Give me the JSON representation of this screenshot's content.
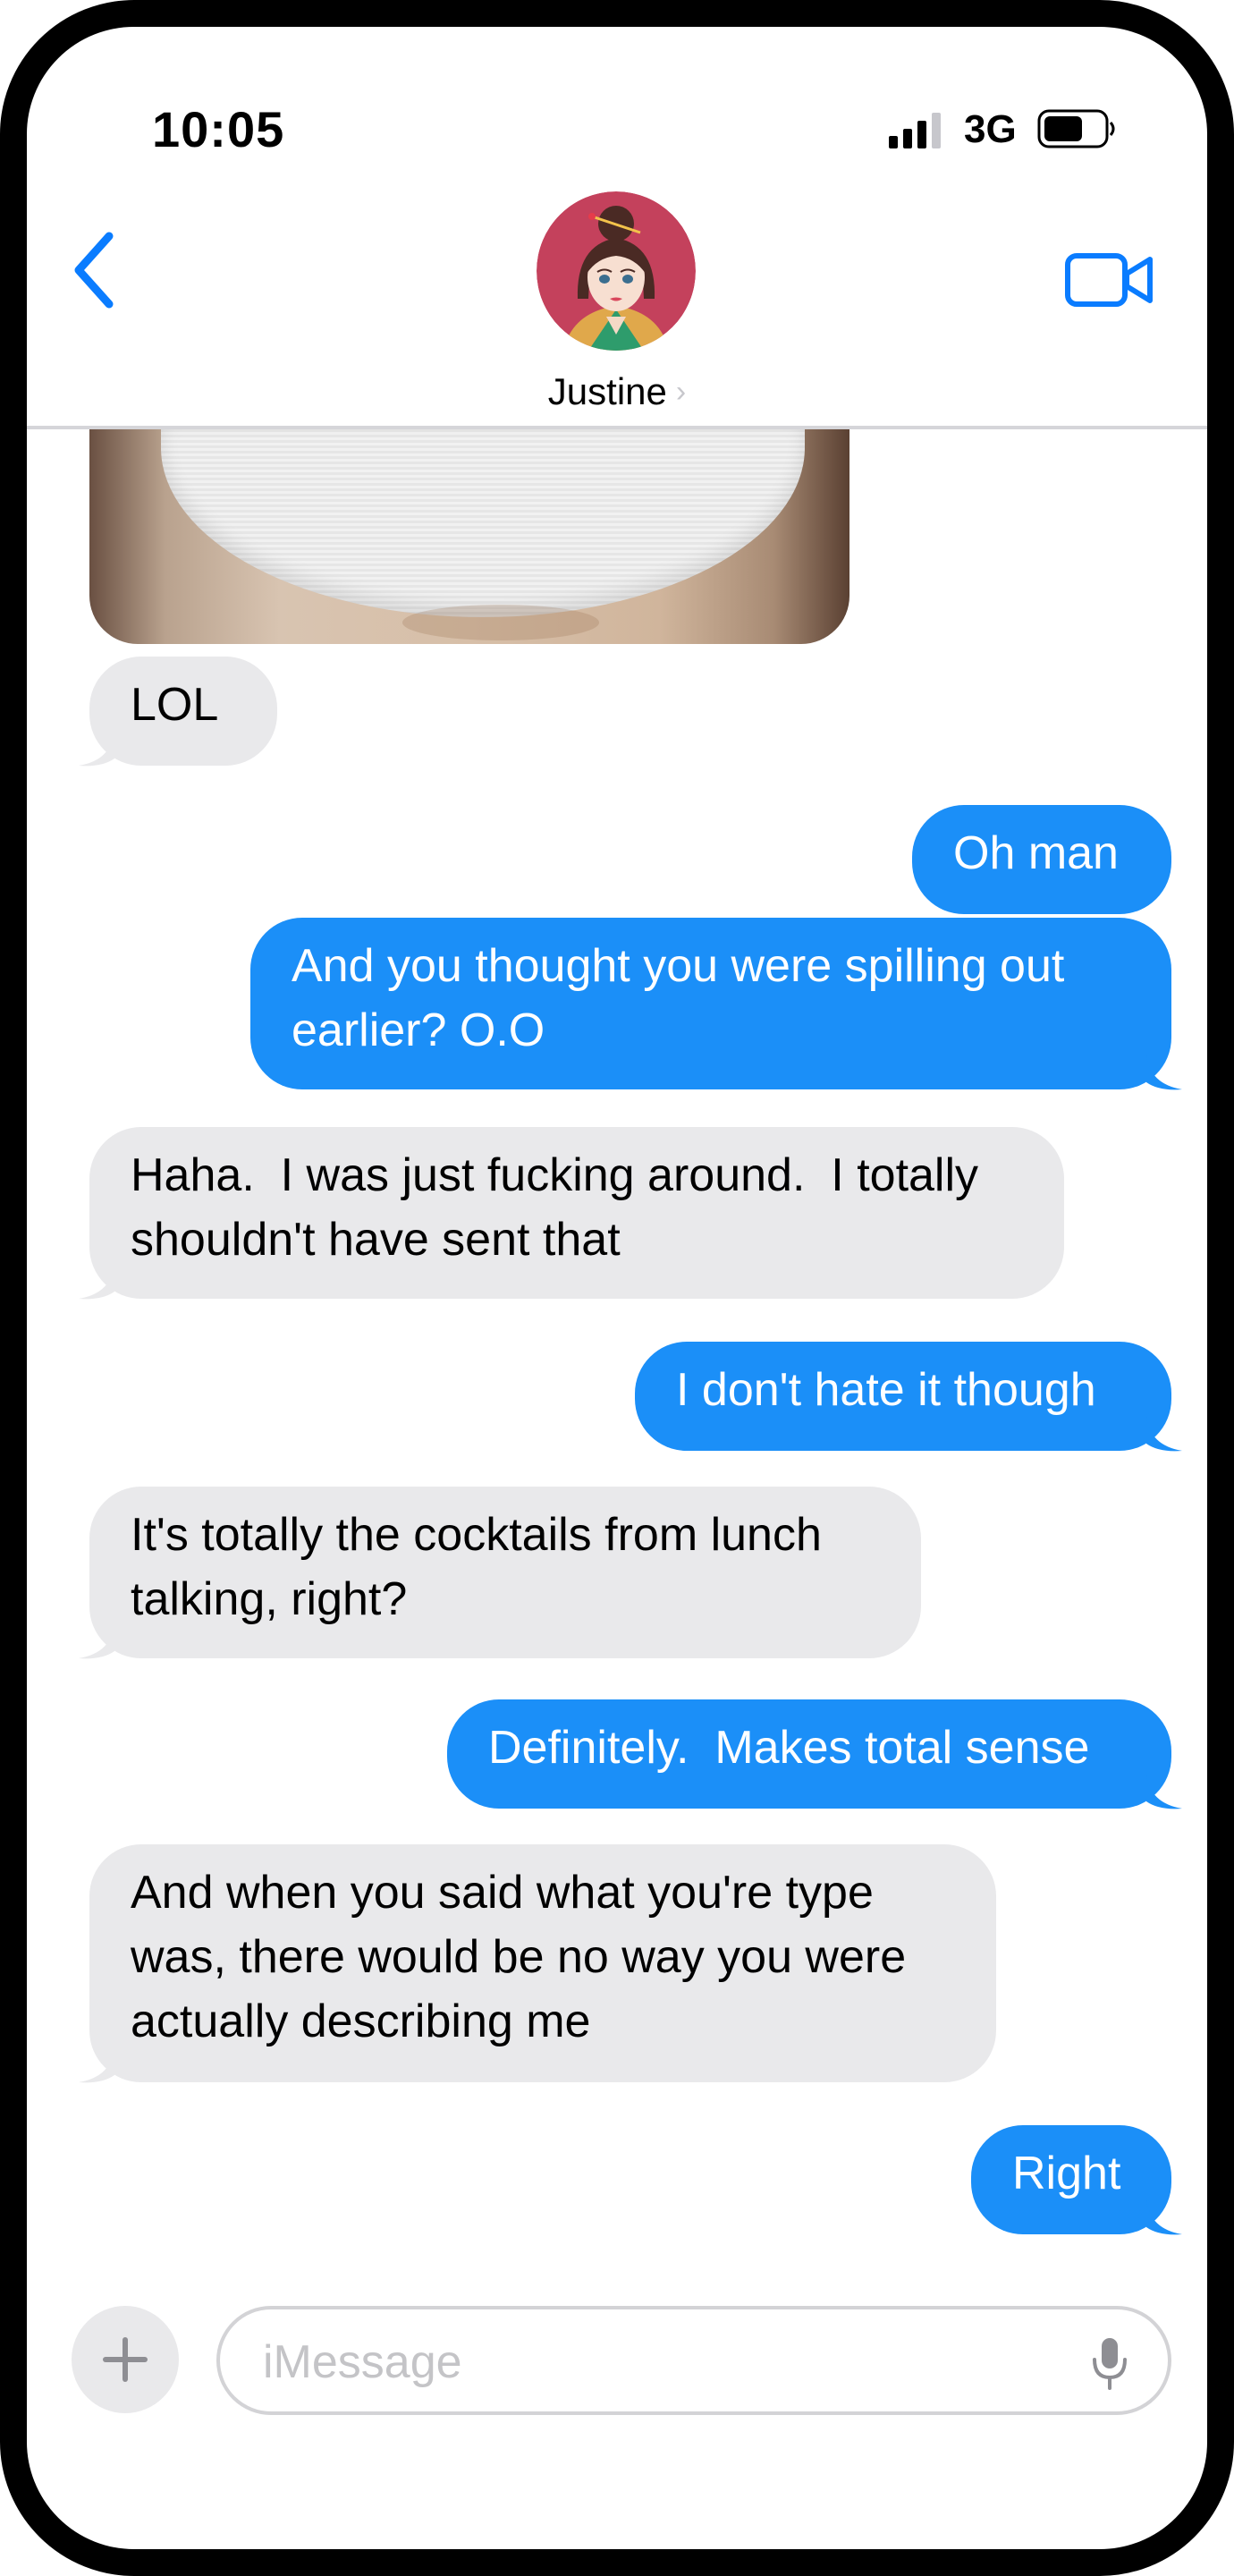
{
  "status_bar": {
    "time": "10:05",
    "network": "3G",
    "icons": [
      "cellular-signal-icon",
      "battery-icon"
    ]
  },
  "header": {
    "contact_name": "Justine",
    "back_icon": "chevron-left-icon",
    "video_icon": "facetime-video-icon",
    "chevron": "›"
  },
  "messages": [
    {
      "from": "them",
      "text": "LOL"
    },
    {
      "from": "me",
      "text": "Oh man"
    },
    {
      "from": "me",
      "text": "And you thought you were spilling out\nearlier? O.O"
    },
    {
      "from": "them",
      "text": "Haha.  I was just fucking around.  I totally\nshouldn't have sent that"
    },
    {
      "from": "me",
      "text": "I don't hate it though"
    },
    {
      "from": "them",
      "text": "It's totally the cocktails from lunch\ntalking, right?"
    },
    {
      "from": "me",
      "text": "Definitely.  Makes total sense"
    },
    {
      "from": "them",
      "text": "And when you said what you're type\nwas, there would be no way you were\nactually describing me"
    },
    {
      "from": "me",
      "text": "Right"
    }
  ],
  "composer": {
    "placeholder": "iMessage",
    "value": "",
    "add_icon": "plus-icon",
    "mic_icon": "microphone-icon"
  },
  "colors": {
    "outgoing_bubble": "#1b8ff8",
    "incoming_bubble": "#e9e9eb",
    "accent": "#0a7cff"
  }
}
